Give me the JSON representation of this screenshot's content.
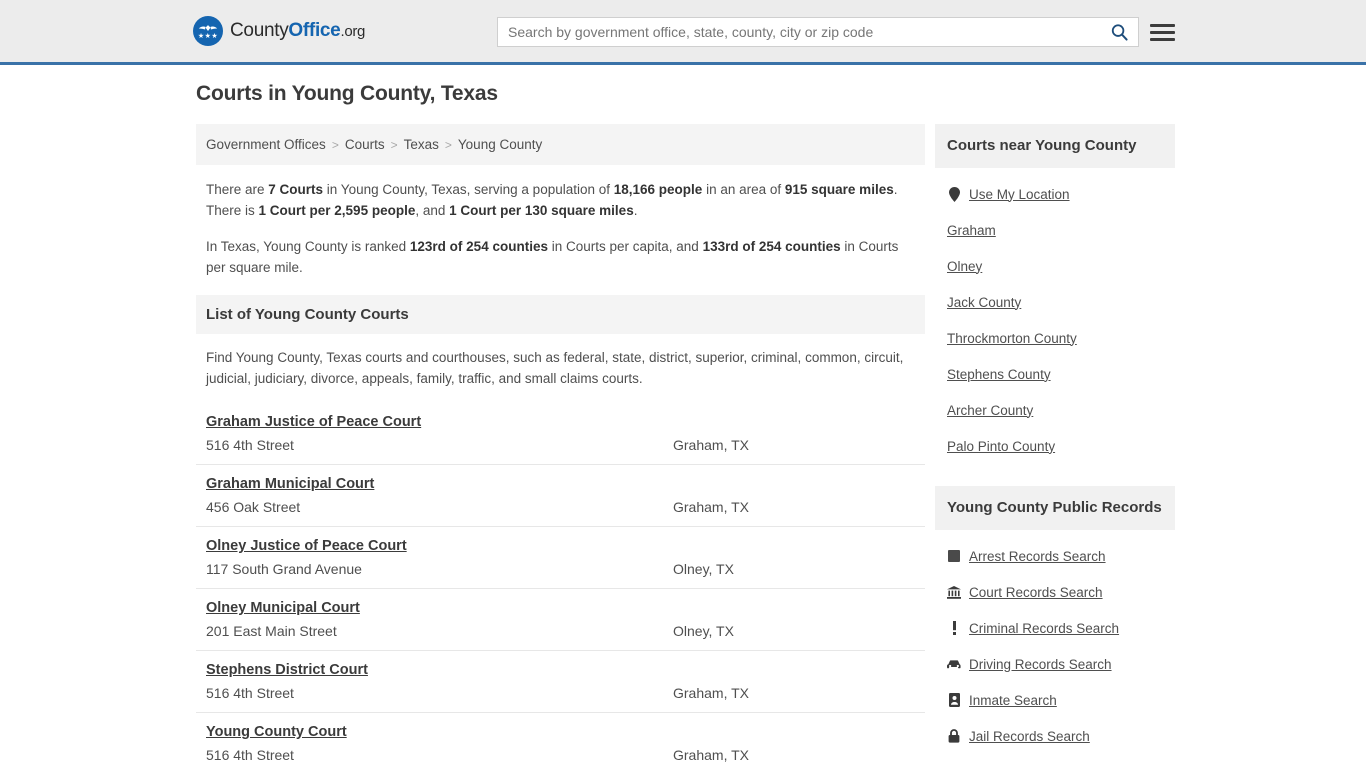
{
  "header": {
    "logo": {
      "icon": "eagle-emblem-icon",
      "text_primary": "County",
      "text_accent": "Office",
      "text_suffix": ".org"
    },
    "search": {
      "placeholder": "Search by government office, state, county, city or zip code",
      "value": "",
      "search_icon": "search-icon"
    },
    "menu_icon": "hamburger-menu-icon",
    "accent_color": "#1565b0",
    "border_color": "#3a72a8"
  },
  "page_title": "Courts in Young County, Texas",
  "breadcrumb": {
    "items": [
      {
        "label": "Government Offices"
      },
      {
        "label": "Courts"
      },
      {
        "label": "Texas"
      },
      {
        "label": "Young County"
      }
    ],
    "separator": ">"
  },
  "stats": {
    "paragraph1": {
      "p1": "There are ",
      "b1": "7 Courts",
      "p2": " in Young County, Texas, serving a population of ",
      "b2": "18,166 people",
      "p3": " in an area of ",
      "b3": "915 square miles",
      "p4": ". There is ",
      "b4": "1 Court per 2,595 people",
      "p5": ", and ",
      "b5": "1 Court per 130 square miles",
      "p6": "."
    },
    "paragraph2": {
      "p1": "In Texas, Young County is ranked ",
      "b1": "123rd of 254 counties",
      "p2": " in Courts per capita, and ",
      "b2": "133rd of 254 counties",
      "p3": " in Courts per square mile."
    }
  },
  "list_section": {
    "heading": "List of Young County Courts",
    "description": "Find Young County, Texas courts and courthouses, such as federal, state, district, superior, criminal, common, circuit, judicial, judiciary, divorce, appeals, family, traffic, and small claims courts."
  },
  "courts": [
    {
      "name": "Graham Justice of Peace Court",
      "address": "516 4th Street",
      "city": "Graham, TX"
    },
    {
      "name": "Graham Municipal Court",
      "address": "456 Oak Street",
      "city": "Graham, TX"
    },
    {
      "name": "Olney Justice of Peace Court",
      "address": "117 South Grand Avenue",
      "city": "Olney, TX"
    },
    {
      "name": "Olney Municipal Court",
      "address": "201 East Main Street",
      "city": "Olney, TX"
    },
    {
      "name": "Stephens District Court",
      "address": "516 4th Street",
      "city": "Graham, TX"
    },
    {
      "name": "Young County Court",
      "address": "516 4th Street",
      "city": "Graham, TX"
    }
  ],
  "nearby": {
    "heading": "Courts near Young County",
    "items": [
      {
        "label": "Use My Location",
        "icon": "map-pin-icon"
      },
      {
        "label": "Graham",
        "icon": ""
      },
      {
        "label": "Olney",
        "icon": ""
      },
      {
        "label": "Jack County",
        "icon": ""
      },
      {
        "label": "Throckmorton County",
        "icon": ""
      },
      {
        "label": "Stephens County",
        "icon": ""
      },
      {
        "label": "Archer County",
        "icon": ""
      },
      {
        "label": "Palo Pinto County",
        "icon": ""
      }
    ]
  },
  "public_records": {
    "heading": "Young County Public Records",
    "items": [
      {
        "label": "Arrest Records Search",
        "icon": "fingerprint-square-icon"
      },
      {
        "label": "Court Records Search",
        "icon": "courthouse-icon"
      },
      {
        "label": "Criminal Records Search",
        "icon": "exclamation-icon"
      },
      {
        "label": "Driving Records Search",
        "icon": "car-icon"
      },
      {
        "label": "Inmate Search",
        "icon": "id-badge-icon"
      },
      {
        "label": "Jail Records Search",
        "icon": "lock-icon"
      }
    ]
  }
}
